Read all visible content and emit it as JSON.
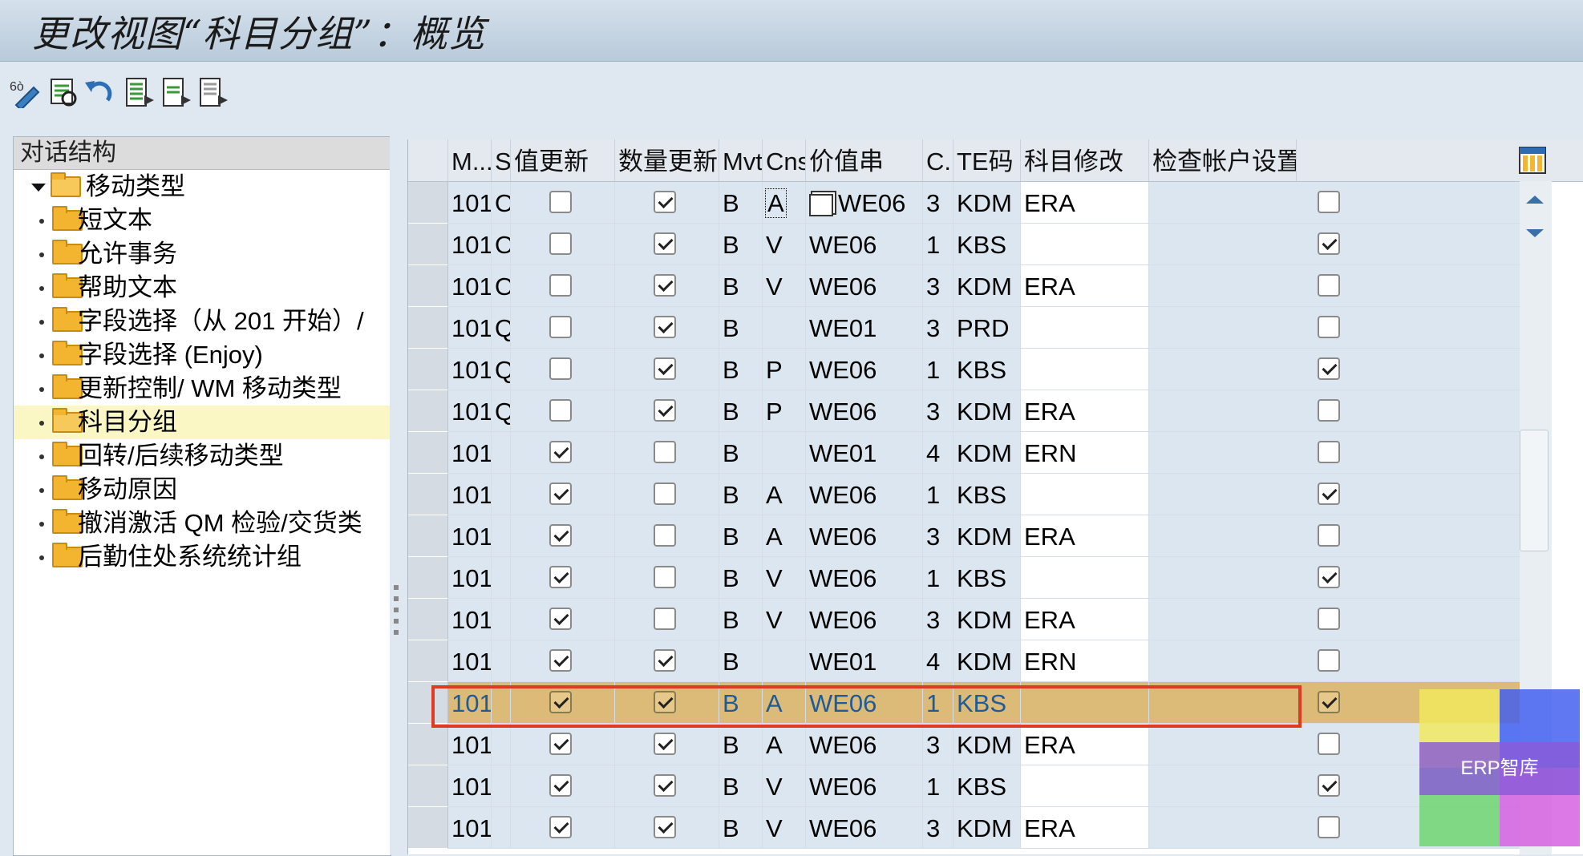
{
  "window": {
    "title": "更改视图“科目分组”：概览"
  },
  "toolbar": {
    "buttons": [
      "change-display-icon",
      "select-icon",
      "undo-icon",
      "select-all-icon",
      "select-block-icon",
      "deselect-all-icon"
    ]
  },
  "dialog_structure": {
    "header": "对话结构",
    "root": "移动类型",
    "items": [
      {
        "label": "短文本",
        "selected": false
      },
      {
        "label": "允许事务",
        "selected": false
      },
      {
        "label": "帮助文本",
        "selected": false
      },
      {
        "label": "字段选择（从 201 开始）/",
        "selected": false
      },
      {
        "label": "字段选择 (Enjoy)",
        "selected": false
      },
      {
        "label": "更新控制/ WM 移动类型",
        "selected": false
      },
      {
        "label": "科目分组",
        "selected": true
      },
      {
        "label": "回转/后续移动类型",
        "selected": false
      },
      {
        "label": "移动原因",
        "selected": false
      },
      {
        "label": "撤消激活 QM 检验/交货类",
        "selected": false
      },
      {
        "label": "后勤住处系统统计组",
        "selected": false
      }
    ]
  },
  "table": {
    "columns": [
      "M...",
      "S",
      "值更新",
      "数量更新",
      "Mvt",
      "Cns",
      "价值串",
      "C..",
      "TE码",
      "科目修改",
      "检查帐户设置"
    ],
    "rows": [
      {
        "m": "101",
        "s": "O",
        "val": false,
        "qty": true,
        "mvt": "B",
        "cns": "A",
        "vs": "WE06",
        "c": "3",
        "te": "KDM",
        "acct": "ERA",
        "chk": false,
        "focused": true
      },
      {
        "m": "101",
        "s": "O",
        "val": false,
        "qty": true,
        "mvt": "B",
        "cns": "V",
        "vs": "WE06",
        "c": "1",
        "te": "KBS",
        "acct": "",
        "chk": true
      },
      {
        "m": "101",
        "s": "O",
        "val": false,
        "qty": true,
        "mvt": "B",
        "cns": "V",
        "vs": "WE06",
        "c": "3",
        "te": "KDM",
        "acct": "ERA",
        "chk": false
      },
      {
        "m": "101",
        "s": "Q",
        "val": false,
        "qty": true,
        "mvt": "B",
        "cns": "",
        "vs": "WE01",
        "c": "3",
        "te": "PRD",
        "acct": "",
        "chk": false
      },
      {
        "m": "101",
        "s": "Q",
        "val": false,
        "qty": true,
        "mvt": "B",
        "cns": "P",
        "vs": "WE06",
        "c": "1",
        "te": "KBS",
        "acct": "",
        "chk": true
      },
      {
        "m": "101",
        "s": "Q",
        "val": false,
        "qty": true,
        "mvt": "B",
        "cns": "P",
        "vs": "WE06",
        "c": "3",
        "te": "KDM",
        "acct": "ERA",
        "chk": false
      },
      {
        "m": "101",
        "s": "",
        "val": true,
        "qty": false,
        "mvt": "B",
        "cns": "",
        "vs": "WE01",
        "c": "4",
        "te": "KDM",
        "acct": "ERN",
        "chk": false
      },
      {
        "m": "101",
        "s": "",
        "val": true,
        "qty": false,
        "mvt": "B",
        "cns": "A",
        "vs": "WE06",
        "c": "1",
        "te": "KBS",
        "acct": "",
        "chk": true
      },
      {
        "m": "101",
        "s": "",
        "val": true,
        "qty": false,
        "mvt": "B",
        "cns": "A",
        "vs": "WE06",
        "c": "3",
        "te": "KDM",
        "acct": "ERA",
        "chk": false
      },
      {
        "m": "101",
        "s": "",
        "val": true,
        "qty": false,
        "mvt": "B",
        "cns": "V",
        "vs": "WE06",
        "c": "1",
        "te": "KBS",
        "acct": "",
        "chk": true
      },
      {
        "m": "101",
        "s": "",
        "val": true,
        "qty": false,
        "mvt": "B",
        "cns": "V",
        "vs": "WE06",
        "c": "3",
        "te": "KDM",
        "acct": "ERA",
        "chk": false
      },
      {
        "m": "101",
        "s": "",
        "val": true,
        "qty": true,
        "mvt": "B",
        "cns": "",
        "vs": "WE01",
        "c": "4",
        "te": "KDM",
        "acct": "ERN",
        "chk": false
      },
      {
        "m": "101",
        "s": "",
        "val": true,
        "qty": true,
        "mvt": "B",
        "cns": "A",
        "vs": "WE06",
        "c": "1",
        "te": "KBS",
        "acct": "",
        "chk": true,
        "highlighted": true
      },
      {
        "m": "101",
        "s": "",
        "val": true,
        "qty": true,
        "mvt": "B",
        "cns": "A",
        "vs": "WE06",
        "c": "3",
        "te": "KDM",
        "acct": "ERA",
        "chk": false
      },
      {
        "m": "101",
        "s": "",
        "val": true,
        "qty": true,
        "mvt": "B",
        "cns": "V",
        "vs": "WE06",
        "c": "1",
        "te": "KBS",
        "acct": "",
        "chk": true
      },
      {
        "m": "101",
        "s": "",
        "val": true,
        "qty": true,
        "mvt": "B",
        "cns": "V",
        "vs": "WE06",
        "c": "3",
        "te": "KDM",
        "acct": "ERA",
        "chk": false
      }
    ]
  },
  "watermark": {
    "text": "ERP智库"
  },
  "colors": {
    "highlight_row": "#dcbb78",
    "highlight_border": "#e03a24",
    "readonly_cell": "#dbe6f0",
    "folder": "#f3b52f"
  }
}
